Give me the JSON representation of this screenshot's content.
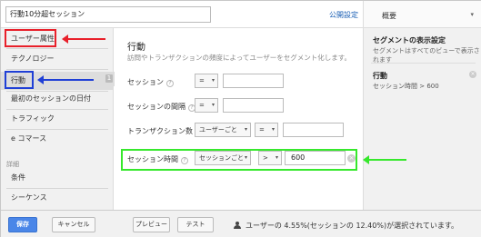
{
  "header": {
    "segment_name": "行動10分超セッション",
    "public_settings_link": "公開設定"
  },
  "sidebar": {
    "items": [
      {
        "label": "ユーザー属性"
      },
      {
        "label": "テクノロジー"
      },
      {
        "label": "行動",
        "badge": "1"
      },
      {
        "label": "最初のセッションの日付"
      },
      {
        "label": "トラフィック"
      },
      {
        "label": "e コマース"
      }
    ],
    "advanced_section_label": "詳細",
    "advanced_items": [
      {
        "label": "条件"
      },
      {
        "label": "シーケンス"
      }
    ]
  },
  "main": {
    "title": "行動",
    "description": "訪問やトランザクションの頻度によってユーザーをセグメント化します。",
    "rows": [
      {
        "label": "セッション",
        "operator": "=",
        "value": ""
      },
      {
        "label": "セッションの間隔",
        "operator": "=",
        "value": ""
      },
      {
        "label": "トランザクション数",
        "scope": "ユーザーごと",
        "operator": "=",
        "value": ""
      },
      {
        "label": "セッション時間",
        "scope": "セッションごと",
        "operator": ">",
        "value": "600"
      }
    ]
  },
  "rightpanel": {
    "header_label": "概要",
    "section_title": "セグメントの表示設定",
    "section_desc": "セグメントはすべてのビューで表示されます",
    "item_title": "行動",
    "item_desc": "セッション時間 > 600"
  },
  "footer": {
    "save_label": "保存",
    "cancel_label": "キャンセル",
    "preview_label": "プレビュー",
    "test_label": "テスト",
    "status_text": "ユーザーの 4.55%(セッションの 12.40%)が選択されています。"
  },
  "colors": {
    "annotation_red": "#e8202a",
    "annotation_blue": "#1f3fd6",
    "annotation_green": "#36e82c",
    "primary_button": "#4a86e8",
    "link": "#1a5fb4"
  }
}
